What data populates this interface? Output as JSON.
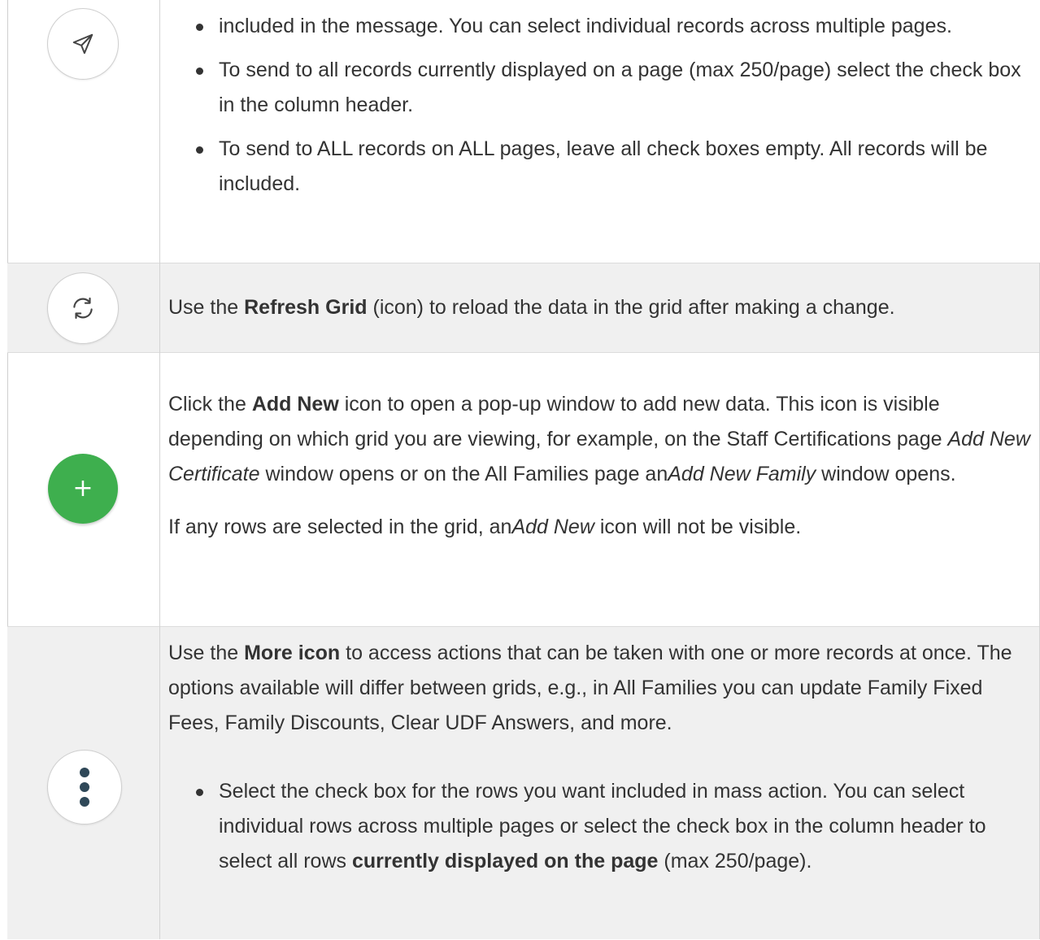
{
  "rows": {
    "send": {
      "bullets": [
        "included in the message. You can select individual records across multiple pages.",
        "To send to all records currently displayed on a page (max 250/page) select the check box in the column header.",
        "To send to ALL records on ALL pages, leave all check boxes empty. All records will be included."
      ],
      "icon": "send-icon"
    },
    "refresh": {
      "pre": "Use the ",
      "bold": "Refresh Grid",
      "post": " (icon) to reload the data in the grid after making a change.",
      "icon": "refresh-icon"
    },
    "add_new": {
      "p1_pre": "Click the ",
      "p1_bold": "Add New",
      "p1_mid": " icon to open a pop-up window to add new data. This icon is visible depending on which grid you are viewing, for example, on the Staff Certifications page ",
      "p1_italic1": "Add New Certificate",
      "p1_mid2": " window opens or on the All Families page an",
      "p1_italic2": "Add New Family",
      "p1_post": " window opens.",
      "p2_pre": "If any rows are selected in the grid, an",
      "p2_italic": "Add New",
      "p2_post": " icon will not be visible.",
      "icon_glyph": "+",
      "accent": "#3eaf4e"
    },
    "more": {
      "p1_pre": "Use the ",
      "p1_bold": "More icon",
      "p1_post": " to access actions that can be taken with one or more records at once. The options available will differ between grids, e.g., in All Families you can update Family Fixed Fees, Family Discounts, Clear UDF Answers, and more.",
      "b1_pre": "Select the check box for the rows you want included in mass action. You can select individual rows across multiple pages or select the check box in the column header to select all rows ",
      "b1_bold": "currently displayed on the page",
      "b1_post": " (max 250/page).",
      "icon": "more-vertical-icon",
      "dot_color": "#2f4858"
    }
  }
}
